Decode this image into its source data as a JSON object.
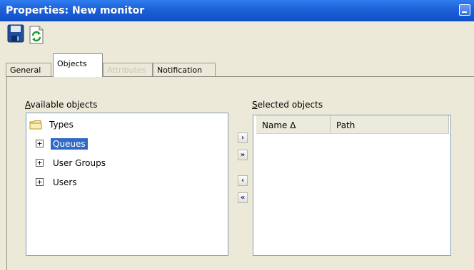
{
  "window": {
    "title": "Properties: New monitor"
  },
  "toolbar": {
    "save_icon": "save-icon",
    "refresh_icon": "refresh-icon"
  },
  "tabs": [
    {
      "label": "General",
      "state": "normal"
    },
    {
      "label": "Objects",
      "state": "active"
    },
    {
      "label": "Attributes",
      "state": "disabled"
    },
    {
      "label": "Notification",
      "state": "normal"
    }
  ],
  "available": {
    "label_accel": "A",
    "label_rest": "vailable objects",
    "root": "Types",
    "items": [
      "Queues",
      "User Groups",
      "Users"
    ],
    "selected_item": "Queues"
  },
  "transfer": {
    "add": "›",
    "add_all": "»",
    "remove": "‹",
    "remove_all": "«"
  },
  "selected": {
    "label_accel": "S",
    "label_rest": "elected objects",
    "columns": [
      "Name Δ",
      "Path"
    ]
  },
  "colors": {
    "titlebar": "#0f4fc8",
    "selection": "#316ac5",
    "face": "#ece9d8"
  }
}
